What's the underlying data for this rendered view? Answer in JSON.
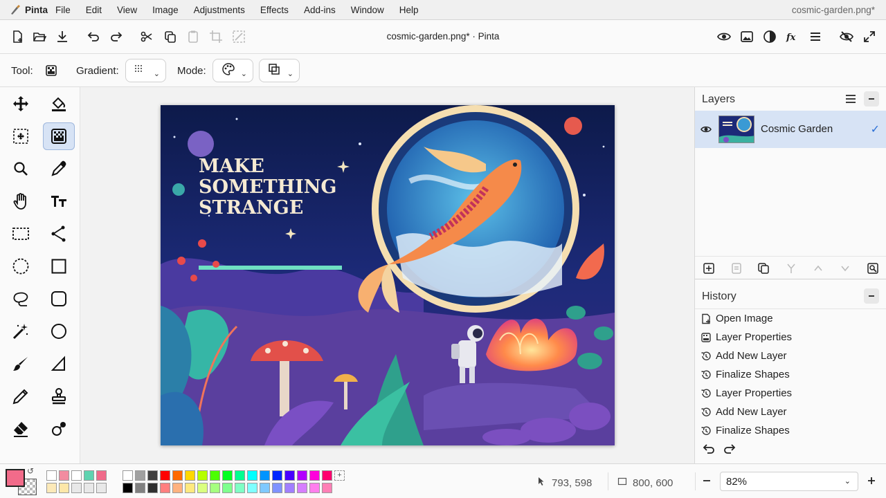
{
  "menubar": {
    "app_name": "Pinta",
    "items": [
      "File",
      "Edit",
      "View",
      "Image",
      "Adjustments",
      "Effects",
      "Add-ins",
      "Window",
      "Help"
    ],
    "document_title": "cosmic-garden.png*"
  },
  "toolbar": {
    "window_title": "cosmic-garden.png* · Pinta",
    "left_icons": [
      "new-image-icon",
      "open-icon",
      "save-icon",
      "undo-icon",
      "redo-icon",
      "cut-icon",
      "copy-icon",
      "paste-icon",
      "crop-icon",
      "deselect-icon"
    ],
    "right_icons": [
      "eye-icon",
      "image-icon",
      "adjustments-icon",
      "effects-icon",
      "menu-icon",
      "hide-icon",
      "fullscreen-icon"
    ]
  },
  "tool_options": {
    "tool_label": "Tool:",
    "gradient_label": "Gradient:",
    "mode_label": "Mode:"
  },
  "tools": [
    "move-selected-icon",
    "paint-bucket-icon",
    "move-selection-icon",
    "gradient-icon",
    "zoom-icon",
    "color-picker-icon",
    "pan-icon",
    "text-icon",
    "rectangle-select-icon",
    "line-curve-icon",
    "ellipse-select-icon",
    "rectangle-icon",
    "lasso-select-icon",
    "rounded-rectangle-icon",
    "magic-wand-icon",
    "ellipse-icon",
    "paintbrush-icon",
    "freeform-shape-icon",
    "pencil-icon",
    "clone-stamp-icon",
    "eraser-icon",
    "recolor-icon"
  ],
  "active_tool": "gradient-icon",
  "canvas": {
    "artwork_text": [
      "MAKE",
      "SOMETHING",
      "STRANGE"
    ]
  },
  "layers": {
    "title": "Layers",
    "items": [
      {
        "name": "Cosmic Garden",
        "visible": true,
        "selected": true
      }
    ]
  },
  "history": {
    "title": "History",
    "items": [
      {
        "label": "Open Image",
        "icon": "open-image-icon"
      },
      {
        "label": "Layer Properties",
        "icon": "layer-properties-icon"
      },
      {
        "label": "Add New Layer",
        "icon": "history-icon"
      },
      {
        "label": "Finalize Shapes",
        "icon": "history-icon"
      },
      {
        "label": "Layer Properties",
        "icon": "history-icon"
      },
      {
        "label": "Add New Layer",
        "icon": "history-icon"
      },
      {
        "label": "Finalize Shapes",
        "icon": "history-icon"
      }
    ]
  },
  "palette": {
    "primary_color": "#f26b8a",
    "secondary_color": "transparent",
    "recent_top": [
      "#ffffff",
      "#f28ca0",
      "#ffffff",
      "#5fd3b0",
      "#f06b8a"
    ],
    "recent_bottom": [
      "#fce9b8",
      "#fde7a8",
      "#e8e8e8",
      "#e8e8e8",
      "#e8e8e8"
    ],
    "top_row": [
      "#ffffff",
      "#a0a0a0",
      "#404040",
      "#ff0000",
      "#ff6a00",
      "#ffd800",
      "#b6ff00",
      "#4cff00",
      "#00ff21",
      "#00ff90",
      "#00ffff",
      "#0094ff",
      "#0026ff",
      "#4800ff",
      "#b200ff",
      "#ff00dc",
      "#ff006e"
    ],
    "bottom_row": [
      "#000000",
      "#808080",
      "#303030",
      "#ff7f7f",
      "#ffb27f",
      "#ffe97f",
      "#daff7f",
      "#a5ff7f",
      "#7fff8e",
      "#7fffc5",
      "#7fffff",
      "#7fc9ff",
      "#7f92ff",
      "#a17fff",
      "#d67fff",
      "#ff7fed",
      "#ff7fb6"
    ]
  },
  "status": {
    "cursor_position": "793, 598",
    "selection_size": "800, 600",
    "zoom": "82%"
  }
}
